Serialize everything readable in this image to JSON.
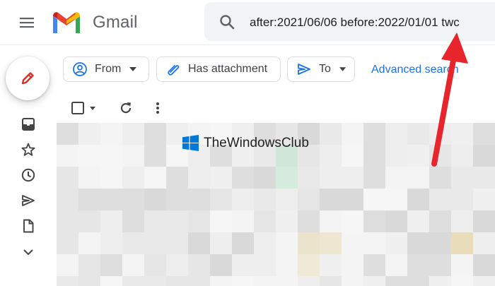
{
  "header": {
    "brand": "Gmail",
    "search_value": "after:2021/06/06 before:2022/01/01 twc"
  },
  "filters": {
    "from_label": "From",
    "attachment_label": "Has attachment",
    "to_label": "To",
    "advanced_label": "Advanced search"
  },
  "watermark": {
    "text": "TheWindowsClub"
  },
  "colors": {
    "accent": "#1a73e8",
    "annotation_arrow": "#e8242c",
    "gmail_red": "#ea4335",
    "gmail_blue": "#4285f4",
    "gmail_green": "#34a853",
    "gmail_yellow": "#fbbc04",
    "watermark_blue": "#0078d7"
  },
  "icons": [
    "menu-icon",
    "gmail-logo",
    "search-icon",
    "pencil-icon",
    "inbox-icon",
    "star-icon",
    "clock-icon",
    "send-icon",
    "document-icon",
    "chevron-down-icon",
    "person-icon",
    "paperclip-icon",
    "send-to-icon",
    "checkbox-icon",
    "refresh-icon",
    "more-vert-icon",
    "windows-logo"
  ]
}
